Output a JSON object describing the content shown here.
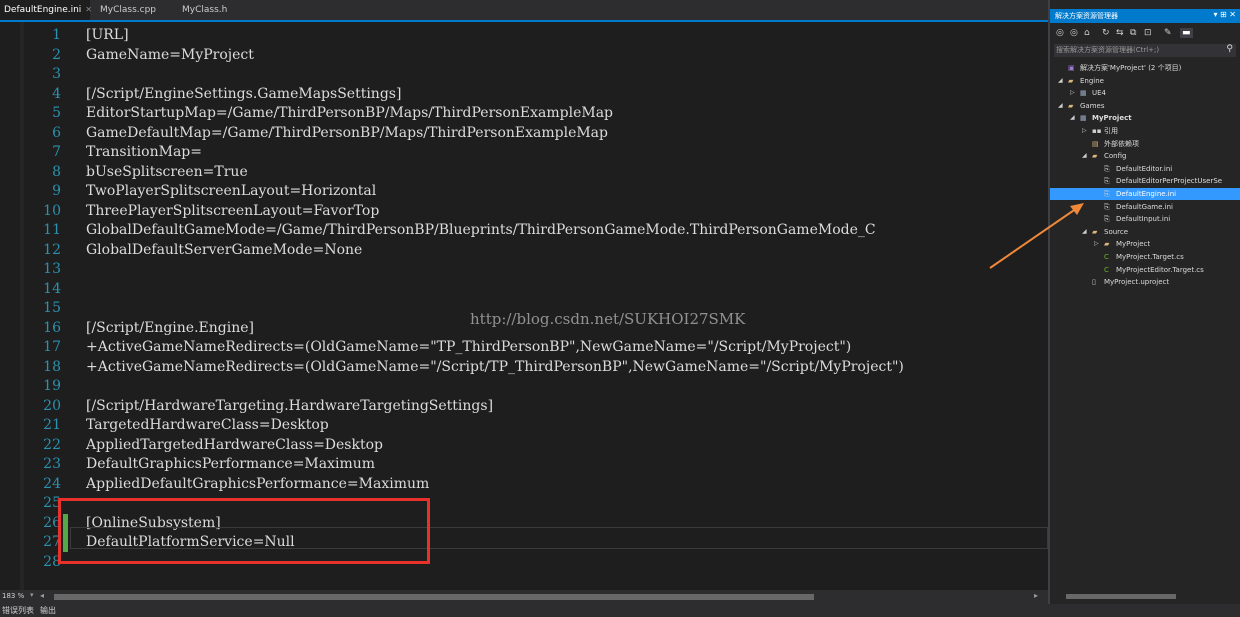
{
  "tabs": [
    {
      "label": "DefaultEngine.ini",
      "active": true,
      "close": "✕"
    },
    {
      "label": "MyClass.cpp",
      "active": false
    },
    {
      "label": "MyClass.h",
      "active": false
    }
  ],
  "editor": {
    "lines": [
      {
        "n": "1",
        "text": "[URL]"
      },
      {
        "n": "2",
        "text": "GameName=MyProject"
      },
      {
        "n": "3",
        "text": ""
      },
      {
        "n": "4",
        "text": "[/Script/EngineSettings.GameMapsSettings]"
      },
      {
        "n": "5",
        "text": "EditorStartupMap=/Game/ThirdPersonBP/Maps/ThirdPersonExampleMap"
      },
      {
        "n": "6",
        "text": "GameDefaultMap=/Game/ThirdPersonBP/Maps/ThirdPersonExampleMap"
      },
      {
        "n": "7",
        "text": "TransitionMap="
      },
      {
        "n": "8",
        "text": "bUseSplitscreen=True"
      },
      {
        "n": "9",
        "text": "TwoPlayerSplitscreenLayout=Horizontal"
      },
      {
        "n": "10",
        "text": "ThreePlayerSplitscreenLayout=FavorTop"
      },
      {
        "n": "11",
        "text": "GlobalDefaultGameMode=/Game/ThirdPersonBP/Blueprints/ThirdPersonGameMode.ThirdPersonGameMode_C"
      },
      {
        "n": "12",
        "text": "GlobalDefaultServerGameMode=None"
      },
      {
        "n": "13",
        "text": ""
      },
      {
        "n": "14",
        "text": ""
      },
      {
        "n": "15",
        "text": ""
      },
      {
        "n": "16",
        "text": "[/Script/Engine.Engine]"
      },
      {
        "n": "17",
        "text": "+ActiveGameNameRedirects=(OldGameName=\"TP_ThirdPersonBP\",NewGameName=\"/Script/MyProject\")"
      },
      {
        "n": "18",
        "text": "+ActiveGameNameRedirects=(OldGameName=\"/Script/TP_ThirdPersonBP\",NewGameName=\"/Script/MyProject\")"
      },
      {
        "n": "19",
        "text": ""
      },
      {
        "n": "20",
        "text": "[/Script/HardwareTargeting.HardwareTargetingSettings]"
      },
      {
        "n": "21",
        "text": "TargetedHardwareClass=Desktop"
      },
      {
        "n": "22",
        "text": "AppliedTargetedHardwareClass=Desktop"
      },
      {
        "n": "23",
        "text": "DefaultGraphicsPerformance=Maximum"
      },
      {
        "n": "24",
        "text": "AppliedDefaultGraphicsPerformance=Maximum"
      },
      {
        "n": "25",
        "text": ""
      },
      {
        "n": "26",
        "text": "[OnlineSubsystem]",
        "changed": true
      },
      {
        "n": "27",
        "text": "DefaultPlatformService=Null",
        "changed": true
      },
      {
        "n": "28",
        "text": ""
      }
    ]
  },
  "watermark": "http://blog.csdn.net/SUKHOI27SMK",
  "status": {
    "zoom": "183 %",
    "bottom_tabs": [
      "错误列表",
      "输出"
    ]
  },
  "solution_explorer": {
    "title": "解决方案资源管理器",
    "title_buttons": "▾ ⊞ ✕",
    "search_placeholder": "搜索解决方案资源管理器(Ctrl+;)",
    "tree": [
      {
        "label": "解决方案'MyProject' (2 个项目)",
        "depth": 0,
        "arrow": "",
        "icon": "solution-icon",
        "bold": false
      },
      {
        "label": "Engine",
        "depth": 0,
        "arrow": "◢",
        "icon": "folder-icon",
        "bold": false
      },
      {
        "label": "UE4",
        "depth": 1,
        "arrow": "▷",
        "icon": "cpp-project-icon",
        "bold": false
      },
      {
        "label": "Games",
        "depth": 0,
        "arrow": "◢",
        "icon": "folder-icon",
        "bold": false
      },
      {
        "label": "MyProject",
        "depth": 1,
        "arrow": "◢",
        "icon": "cpp-project-icon",
        "bold": true
      },
      {
        "label": "引用",
        "depth": 2,
        "arrow": "▷",
        "icon": "references-icon",
        "bold": false
      },
      {
        "label": "外部依赖项",
        "depth": 2,
        "arrow": "",
        "icon": "external-deps-icon",
        "bold": false
      },
      {
        "label": "Config",
        "depth": 2,
        "arrow": "◢",
        "icon": "folder-icon",
        "bold": false
      },
      {
        "label": "DefaultEditor.ini",
        "depth": 3,
        "arrow": "",
        "icon": "ini-file-icon",
        "bold": false
      },
      {
        "label": "DefaultEditorPerProjectUserSe",
        "depth": 3,
        "arrow": "",
        "icon": "ini-file-icon",
        "bold": false
      },
      {
        "label": "DefaultEngine.ini",
        "depth": 3,
        "arrow": "",
        "icon": "ini-file-icon",
        "bold": false,
        "selected": true
      },
      {
        "label": "DefaultGame.ini",
        "depth": 3,
        "arrow": "",
        "icon": "ini-file-icon",
        "bold": false
      },
      {
        "label": "DefaultInput.ini",
        "depth": 3,
        "arrow": "",
        "icon": "ini-file-icon",
        "bold": false
      },
      {
        "label": "Source",
        "depth": 2,
        "arrow": "◢",
        "icon": "folder-icon",
        "bold": false
      },
      {
        "label": "MyProject",
        "depth": 3,
        "arrow": "▷",
        "icon": "folder-icon",
        "bold": false
      },
      {
        "label": "MyProject.Target.cs",
        "depth": 3,
        "arrow": "",
        "icon": "csharp-file-icon",
        "bold": false
      },
      {
        "label": "MyProjectEditor.Target.cs",
        "depth": 3,
        "arrow": "",
        "icon": "csharp-file-icon",
        "bold": false
      },
      {
        "label": "MyProject.uproject",
        "depth": 2,
        "arrow": "",
        "icon": "file-icon",
        "bold": false
      }
    ]
  },
  "colors": {
    "accent": "#007acc",
    "selection": "#3399ff",
    "annotation_red": "#e8312b",
    "annotation_arrow": "#f0883a",
    "line_number": "#2b91af"
  }
}
